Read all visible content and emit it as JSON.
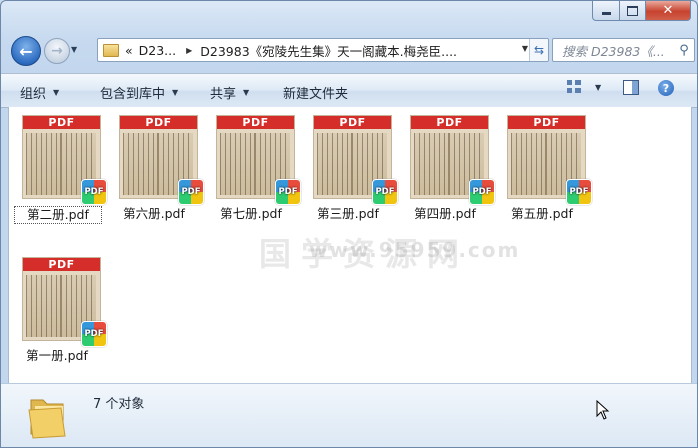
{
  "address": {
    "overflow": "«",
    "segments": [
      "D23...",
      "D23983《宛陵先生集》天一阁藏本.梅尧臣...."
    ]
  },
  "search": {
    "placeholder": "搜索 D23983《..."
  },
  "toolbar": {
    "organize": "组织",
    "include_in_library": "包含到库中",
    "share": "共享",
    "new_folder": "新建文件夹"
  },
  "files": [
    {
      "name": "第二册.pdf",
      "selected": true
    },
    {
      "name": "第六册.pdf",
      "selected": false
    },
    {
      "name": "第七册.pdf",
      "selected": false
    },
    {
      "name": "第三册.pdf",
      "selected": false
    },
    {
      "name": "第四册.pdf",
      "selected": false
    },
    {
      "name": "第五册.pdf",
      "selected": false
    },
    {
      "name": "第一册.pdf",
      "selected": false
    }
  ],
  "thumb_band": "PDF",
  "badge": "PDF",
  "watermark": "国学资源网",
  "watermark_url": "www.95959.com",
  "status": {
    "count_text": "7 个对象"
  },
  "colors": {
    "pdf_band": "#d42d2a",
    "window_frame": "#c2d6ed",
    "close_button": "#c7432f"
  }
}
